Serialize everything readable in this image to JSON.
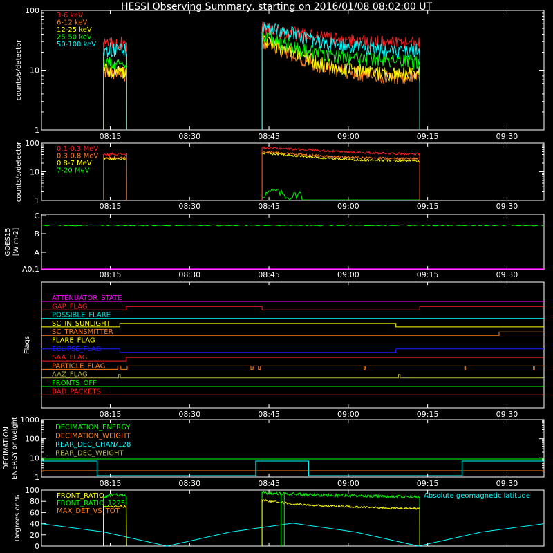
{
  "title": "HESSI Observing Summary, starting on 2016/01/08 08:02:00 UT",
  "colors": {
    "background": "#000000",
    "axes": "#ffffff",
    "red": "#ff2020",
    "orange": "#ff7f1f",
    "yellow": "#ffff00",
    "green": "#00ff00",
    "cyan": "#00ffff",
    "magenta": "#ff00ff",
    "blue": "#1f1fff",
    "olive": "#b4b44a",
    "teal": "#00dcdc"
  },
  "chart_data": [
    {
      "id": "xray",
      "type": "line",
      "ylabel": "counts/s/detector",
      "yscale": "log",
      "ylim": [
        1,
        100
      ],
      "yticks": [
        "1",
        "10",
        "100"
      ],
      "xrange_minutes": [
        0,
        95
      ],
      "xticks": [
        "08:15",
        "08:30",
        "08:45",
        "09:00",
        "09:15",
        "09:30"
      ],
      "tick_minutes": [
        13,
        28,
        43,
        58,
        73,
        88
      ],
      "intervals": [
        [
          11.7,
          16.1
        ],
        [
          41.7,
          71.5
        ]
      ],
      "series": [
        {
          "name": "3-6 keV",
          "color": "red",
          "values": [
            28,
            30,
            27,
            52,
            45,
            40,
            36,
            33,
            31,
            30,
            29,
            28
          ]
        },
        {
          "name": "6-12 keV",
          "color": "orange",
          "values": [
            10,
            9,
            9,
            30,
            22,
            16,
            12,
            10,
            9,
            8,
            8,
            8
          ]
        },
        {
          "name": "12-25 keV",
          "color": "yellow",
          "values": [
            11,
            10,
            10,
            32,
            24,
            17,
            13,
            11,
            10,
            9,
            9,
            9
          ]
        },
        {
          "name": "25-50 keV",
          "color": "green",
          "values": [
            14,
            13,
            13,
            38,
            30,
            23,
            19,
            17,
            16,
            15,
            14,
            14
          ]
        },
        {
          "name": "50-100 keV",
          "color": "cyan",
          "values": [
            22,
            23,
            22,
            55,
            48,
            36,
            29,
            26,
            24,
            23,
            22,
            22
          ]
        }
      ]
    },
    {
      "id": "gamma",
      "type": "line",
      "ylabel": "counts/s/detector",
      "yscale": "log",
      "ylim": [
        1,
        100
      ],
      "yticks": [
        "1",
        "10",
        "100"
      ],
      "xrange_minutes": [
        0,
        95
      ],
      "xticks": [
        "08:15",
        "08:30",
        "08:45",
        "09:00",
        "09:15",
        "09:30"
      ],
      "tick_minutes": [
        13,
        28,
        43,
        58,
        73,
        88
      ],
      "intervals": [
        [
          11.7,
          16.1
        ],
        [
          41.7,
          71.5
        ]
      ],
      "series": [
        {
          "name": "0.1-0.3 MeV",
          "color": "red",
          "values": [
            40,
            42,
            41,
            70,
            65,
            60,
            55,
            50,
            47,
            45,
            43,
            42
          ]
        },
        {
          "name": "0.3-0.8 MeV",
          "color": "orange",
          "values": [
            30,
            31,
            30,
            50,
            45,
            40,
            36,
            33,
            31,
            30,
            29,
            29
          ]
        },
        {
          "name": "0.8-7 MeV",
          "color": "yellow",
          "values": [
            28,
            29,
            28,
            45,
            40,
            35,
            31,
            28,
            26,
            25,
            24,
            24
          ]
        },
        {
          "name": "7-20 MeV",
          "color": "green",
          "values": [
            1.5,
            2.2,
            1.3,
            1.8
          ]
        }
      ]
    },
    {
      "id": "goes",
      "type": "line",
      "ylabel": "GOES15",
      "ylabel2": "[W m-2]",
      "yscale": "log",
      "ytick_labels": [
        "A0.1",
        "A",
        "B",
        "C"
      ],
      "series": [
        {
          "name": "GOES15",
          "color": "green",
          "values": [
            1.5e-06,
            1.5e-06,
            1.5e-06
          ]
        }
      ]
    },
    {
      "id": "flags",
      "type": "line",
      "ylabel": "Flags",
      "rows": [
        {
          "label": "ATTENUATOR_STATE",
          "color": "magenta"
        },
        {
          "label": "GAP_FLAG",
          "color": "red"
        },
        {
          "label": "POSSIBLE_FLARE",
          "color": "teal"
        },
        {
          "label": "SC_IN_SUNLIGHT",
          "color": "yellow"
        },
        {
          "label": "SC_TRANSMITTER",
          "color": "orange"
        },
        {
          "label": "FLARE_FLAG",
          "color": "yellow"
        },
        {
          "label": "ECLIPSE_FLAG",
          "color": "blue"
        },
        {
          "label": "SAA_FLAG",
          "color": "red"
        },
        {
          "label": "PARTICLE_FLAG",
          "color": "orange"
        },
        {
          "label": "AAZ_FLAG",
          "color": "olive"
        },
        {
          "label": "FRONTS_OFF",
          "color": "green"
        },
        {
          "label": "BAD_PACKETS",
          "color": "red"
        }
      ]
    },
    {
      "id": "decimation",
      "type": "line",
      "ylabel": "DECIMATION",
      "ylabel2": "ENERGY or weight",
      "yscale": "log",
      "ylim": [
        1,
        1000
      ],
      "yticks": [
        "1",
        "10",
        "100",
        "1000"
      ],
      "series": [
        {
          "name": "DECIMATION_ENERGY",
          "color": "green"
        },
        {
          "name": "DECIMATION_WEIGHT",
          "color": "orange"
        },
        {
          "name": "REAR_DEC_CHAN/128",
          "color": "cyan"
        },
        {
          "name": "REAR_DEC_WEIGHT",
          "color": "olive"
        }
      ]
    },
    {
      "id": "ratios",
      "type": "line",
      "ylabel": "Degrees or %",
      "ylim": [
        0,
        100
      ],
      "yticks": [
        "0",
        "20",
        "40",
        "60",
        "80",
        "100"
      ],
      "annotation": "Absolute geomagnetic latitude",
      "series": [
        {
          "name": "FRONT_RATIO",
          "color": "yellow",
          "values": [
            72,
            70,
            71,
            82,
            75,
            72,
            70,
            68,
            67
          ]
        },
        {
          "name": "FRONT_RATIO_1225",
          "color": "green",
          "values": [
            88,
            92,
            90,
            95,
            93,
            91,
            90,
            89,
            88
          ]
        },
        {
          "name": "MAX_DET_VS_TOT",
          "color": "orange"
        },
        {
          "name": "Absolute geomagnetic latitude",
          "color": "cyan",
          "values": [
            40,
            25,
            0,
            25,
            41,
            25,
            0,
            25,
            40
          ]
        }
      ]
    }
  ]
}
